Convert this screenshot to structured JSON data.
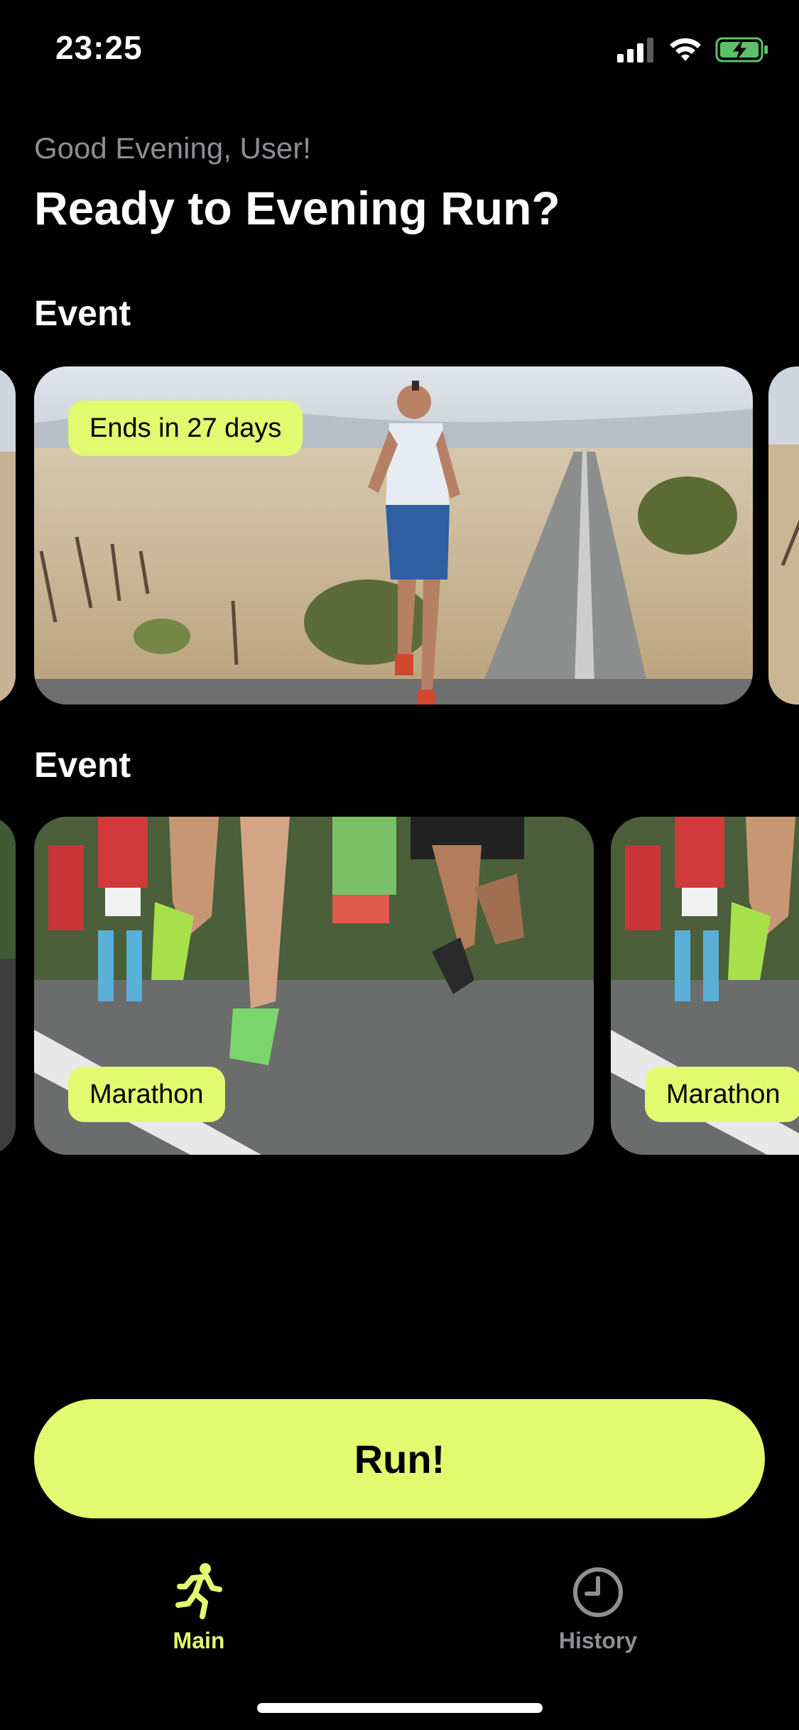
{
  "status_bar": {
    "time": "23:25",
    "icons": [
      "cellular-signal-icon",
      "wifi-icon",
      "battery-charging-icon"
    ]
  },
  "header": {
    "greeting": "Good Evening, User!",
    "headline": "Ready to Evening Run?"
  },
  "sections": [
    {
      "title": "Event",
      "cards": [
        {
          "badge": "Ends in 27 days",
          "image": "runner on desert road"
        }
      ]
    },
    {
      "title": "Event",
      "cards": [
        {
          "badge": "Marathon",
          "image": "marathon runners legs"
        },
        {
          "badge": "Marathon",
          "image": "marathon runners legs"
        }
      ]
    }
  ],
  "run_button": {
    "label": "Run!"
  },
  "tab_bar": {
    "tabs": [
      {
        "label": "Main",
        "icon": "running-person-icon",
        "active": true
      },
      {
        "label": "History",
        "icon": "clock-icon",
        "active": false
      }
    ]
  },
  "colors": {
    "accent": "#e2fa6f",
    "background": "#000000",
    "muted": "#8e8e93",
    "inactive_tab": "#8e8e93"
  }
}
